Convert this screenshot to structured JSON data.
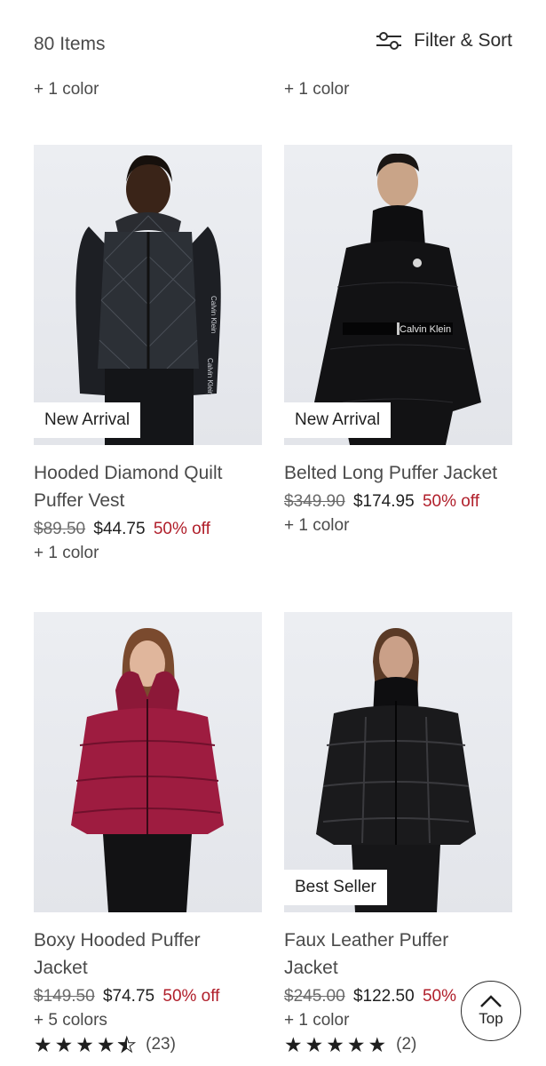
{
  "header": {
    "item_count": "80 Items",
    "filter_label": "Filter & Sort"
  },
  "prev_row": {
    "left_colors": "+ 1 color",
    "right_colors": "+ 1 color"
  },
  "products": [
    {
      "badge": "New Arrival",
      "name_line1": "Hooded Diamond Quilt",
      "name_line2": "Puffer Vest",
      "original_price": "$89.50",
      "sale_price": "$44.75",
      "discount": "50% off",
      "colors": "+ 1 color"
    },
    {
      "badge": "New Arrival",
      "name_line1": "Belted Long Puffer Jacket",
      "name_line2": "",
      "original_price": "$349.90",
      "sale_price": "$174.95",
      "discount": "50% off",
      "colors": "+ 1 color",
      "belt_text": "Calvin Klein"
    },
    {
      "badge": "",
      "name_line1": "Boxy Hooded Puffer",
      "name_line2": "Jacket",
      "original_price": "$149.50",
      "sale_price": "$74.75",
      "discount": "50% off",
      "colors": "+ 5 colors",
      "rating_value": 4.5,
      "rating_count": "(23)"
    },
    {
      "badge": "Best Seller",
      "name_line1": "Faux Leather Puffer",
      "name_line2": "Jacket",
      "original_price": "$245.00",
      "sale_price": "$122.50",
      "discount": "50%",
      "colors": "+ 1 color",
      "rating_value": 5,
      "rating_count": "(2)"
    }
  ],
  "top_button": {
    "label": "Top"
  },
  "colors": {
    "discount_red": "#b01e2a",
    "text_dark": "#1f1f1f",
    "text_gray": "#4a4a4a",
    "image_bg": "#e6e8ec"
  },
  "icons": {
    "filter": "sliders-icon",
    "top": "chevron-up-icon",
    "star": "star-icon"
  }
}
